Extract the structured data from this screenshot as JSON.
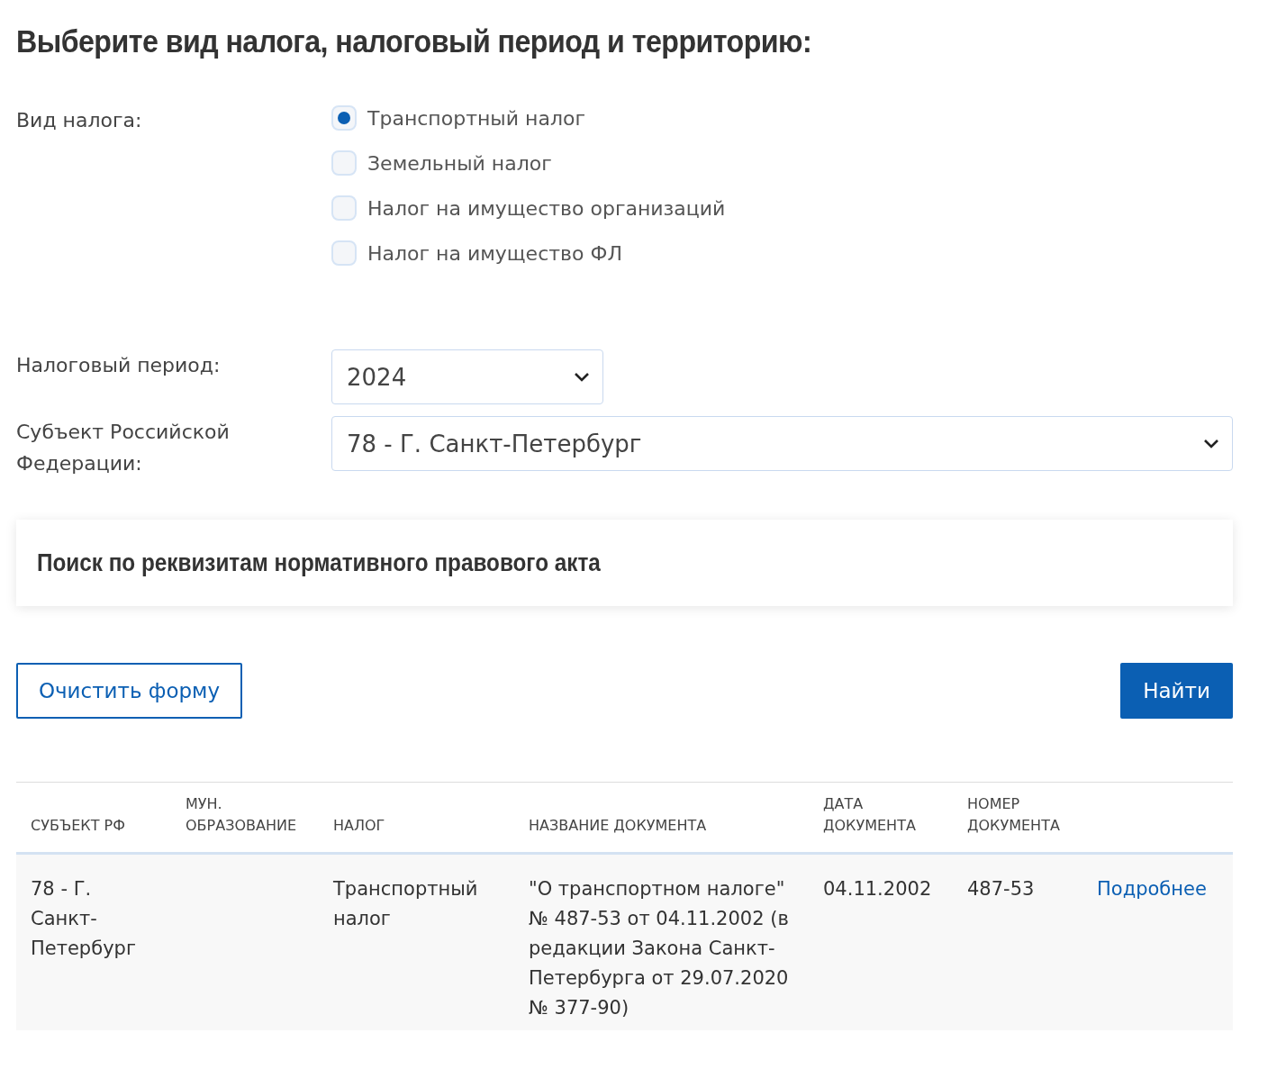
{
  "title": "Выберите вид налога, налоговый период и территорию:",
  "tax_type": {
    "label": "Вид налога:",
    "options": [
      {
        "label": "Транспортный налог",
        "selected": true
      },
      {
        "label": "Земельный налог",
        "selected": false
      },
      {
        "label": "Налог на имущество организаций",
        "selected": false
      },
      {
        "label": "Налог на имущество ФЛ",
        "selected": false
      }
    ]
  },
  "period": {
    "label": "Налоговый период:",
    "value": "2024"
  },
  "region": {
    "label": "Субъект Российской Федерации:",
    "value": "78 - Г. Санкт-Петербург"
  },
  "search_panel": {
    "title": "Поиск по реквизитам нормативного правового акта",
    "expanded": false
  },
  "buttons": {
    "clear": "Очистить форму",
    "find": "Найти"
  },
  "table": {
    "columns": [
      "СУБЪЕКТ РФ",
      "МУН. ОБРАЗОВАНИЕ",
      "НАЛОГ",
      "НАЗВАНИЕ ДОКУМЕНТА",
      "ДАТА ДОКУМЕНТА",
      "НОМЕР ДОКУМЕНТА"
    ],
    "rows": [
      {
        "cells": [
          "78 - Г. Санкт-Петербург",
          "",
          "Транспортный налог",
          "\"О транспортном налоге\" № 487-53 от 04.11.2002 (в редакции Закона Санкт-Петербурга от 29.07.2020 № 377-90)",
          "04.11.2002",
          "487-53"
        ],
        "link": "Подробнее"
      }
    ]
  }
}
